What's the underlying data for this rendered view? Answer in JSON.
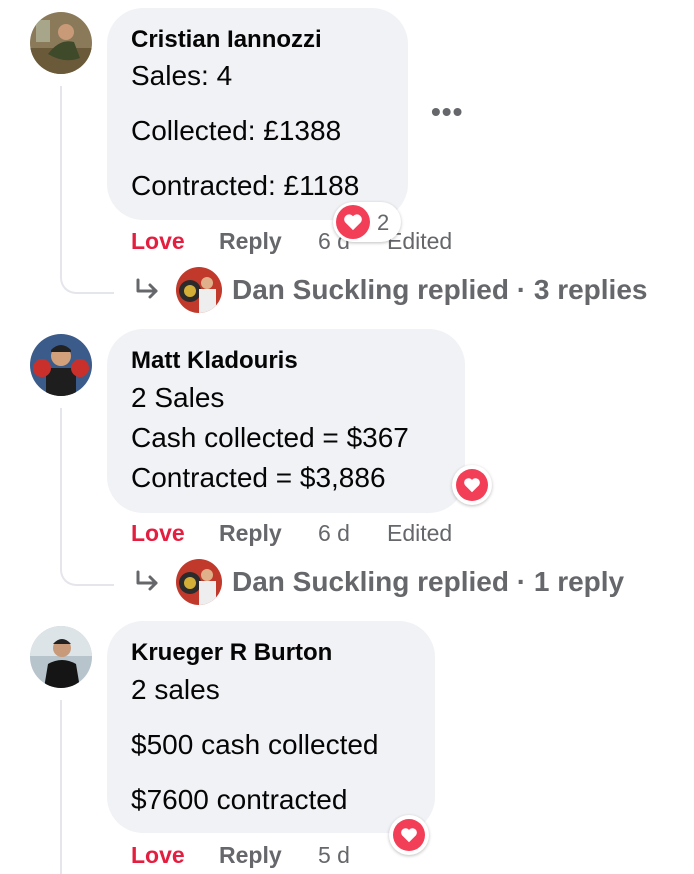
{
  "comments": [
    {
      "author": "Cristian Iannozzi",
      "lines": [
        "Sales: 4",
        "Collected: £1388",
        "Contracted: £1188"
      ],
      "reactions": {
        "icon": "love-reaction-icon",
        "count": "2"
      },
      "actions": {
        "love": "Love",
        "reply": "Reply",
        "time": "6 d",
        "edited": "Edited"
      },
      "more_label": "•••",
      "replies": {
        "name": "Dan Suckling",
        "text": "replied · 3 replies"
      }
    },
    {
      "author": "Matt Kladouris",
      "lines": [
        "2 Sales",
        "Cash collected = $367",
        "Contracted = $3,886"
      ],
      "reactions": {
        "icon": "love-reaction-icon"
      },
      "actions": {
        "love": "Love",
        "reply": "Reply",
        "time": "6 d",
        "edited": "Edited"
      },
      "replies": {
        "name": "Dan Suckling",
        "text": "replied · 1 reply"
      }
    },
    {
      "author": "Krueger R Burton",
      "lines": [
        "2 sales",
        "$500 cash collected",
        "$7600 contracted"
      ],
      "reactions": {
        "icon": "love-reaction-icon"
      },
      "actions": {
        "love": "Love",
        "reply": "Reply",
        "time": "5 d"
      }
    }
  ],
  "colors": {
    "love": "#e41e3f",
    "muted": "#65676b",
    "bubble": "#f0f2f5",
    "heart": "#f33e58"
  }
}
